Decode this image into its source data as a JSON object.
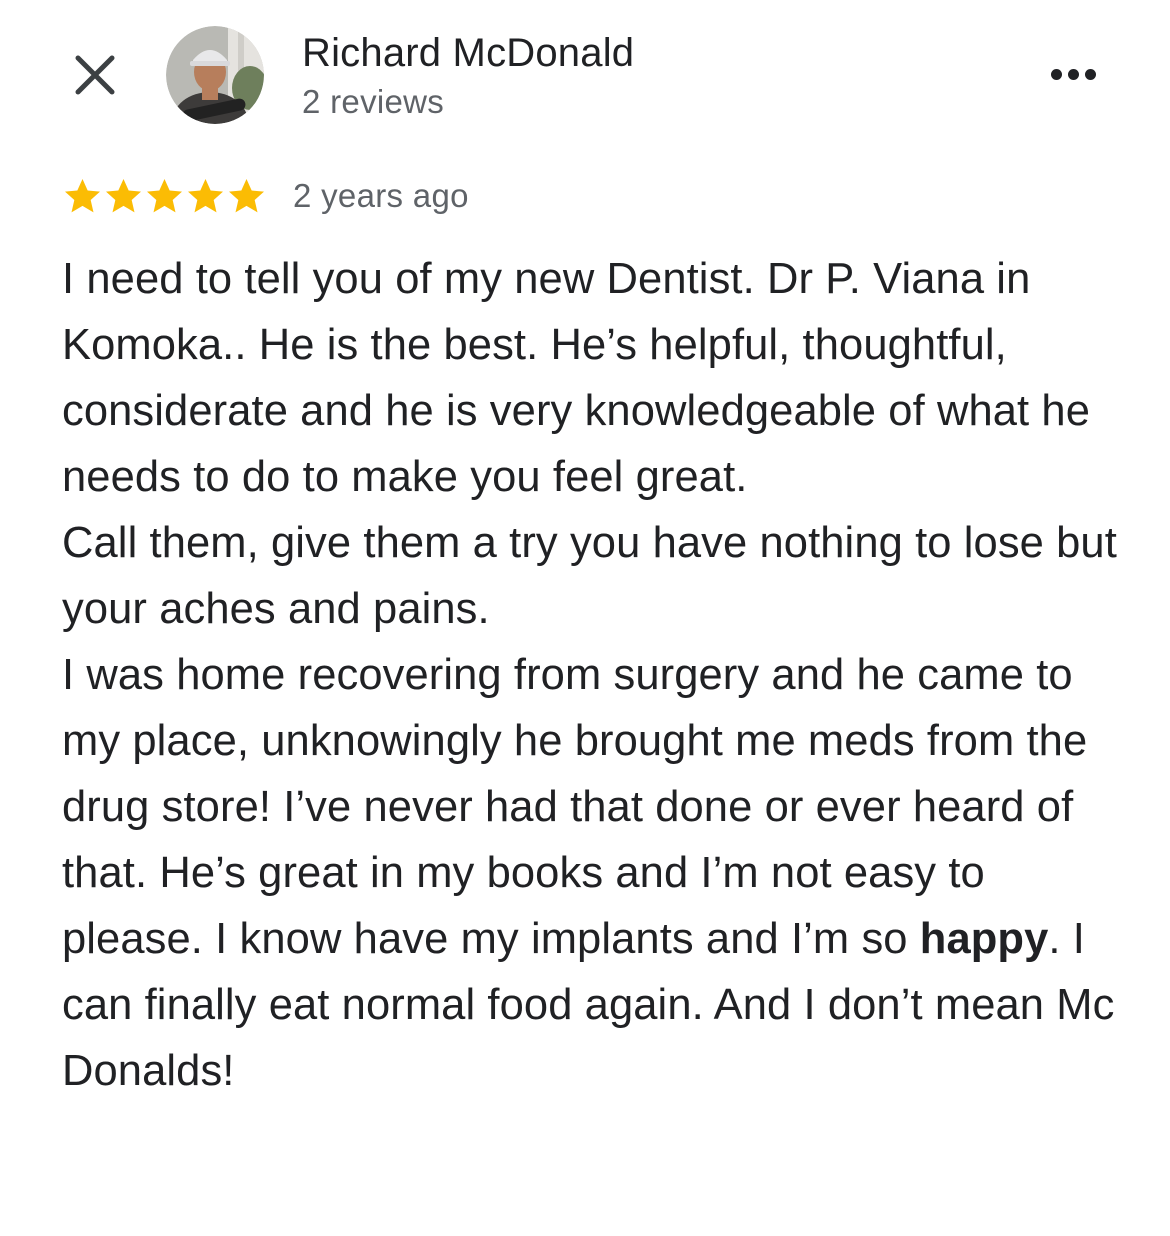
{
  "header": {
    "close_icon": "close-icon",
    "reviewer_name": "Richard McDonald",
    "reviewer_reviews": "2 reviews",
    "more_icon": "more-horizontal-icon"
  },
  "rating": {
    "stars": 5,
    "max_stars": 5,
    "star_color": "#fbbc04",
    "age": "2 years ago"
  },
  "review": {
    "p1": "I need to tell you of my new Dentist. Dr P. Viana in Komoka.. He is the best. He’s helpful, thoughtful, considerate and he is very knowledgeable of what he needs to do to make you feel great.",
    "p2": "Call them, give them a try you have nothing to lose but your aches and pains.",
    "p3_before": "I was home recovering from surgery and he came to my place, unknowingly he brought me meds from the drug store!  I’ve never had that done or ever heard of that. He’s great in my books and I’m not easy to please. I know have my implants and I’m so ",
    "p3_bold": "happy",
    "p3_after": ". I can finally eat normal food again. And I don’t mean Mc Donalds!"
  }
}
